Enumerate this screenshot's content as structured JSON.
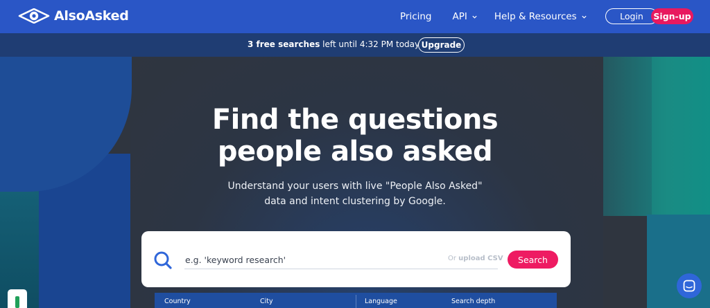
{
  "brand": {
    "name": "AlsoAsked"
  },
  "nav": {
    "pricing": "Pricing",
    "api": "API",
    "help": "Help & Resources",
    "login": "Login",
    "signup": "Sign-up"
  },
  "promo": {
    "count_text": "3 free searches",
    "rest_text": " left until 4:32 PM today",
    "upgrade": "Upgrade"
  },
  "hero": {
    "headline_line1": "Find the questions",
    "headline_line2": "people also asked",
    "sub_line1": "Understand your users with live \"People Also Asked\"",
    "sub_line2": "data and intent clustering by Google."
  },
  "search": {
    "placeholder": "e.g. 'keyword research'",
    "or_text": "Or ",
    "upload_csv": "upload CSV",
    "button": "Search"
  },
  "options": {
    "country": "Country",
    "city": "City",
    "language": "Language",
    "depth": "Search depth"
  },
  "colors": {
    "nav_bg": "#2a56c6",
    "promo_bg": "#1f3d73",
    "accent_pink": "#e8195f",
    "hero_bg": "#2f353f"
  }
}
